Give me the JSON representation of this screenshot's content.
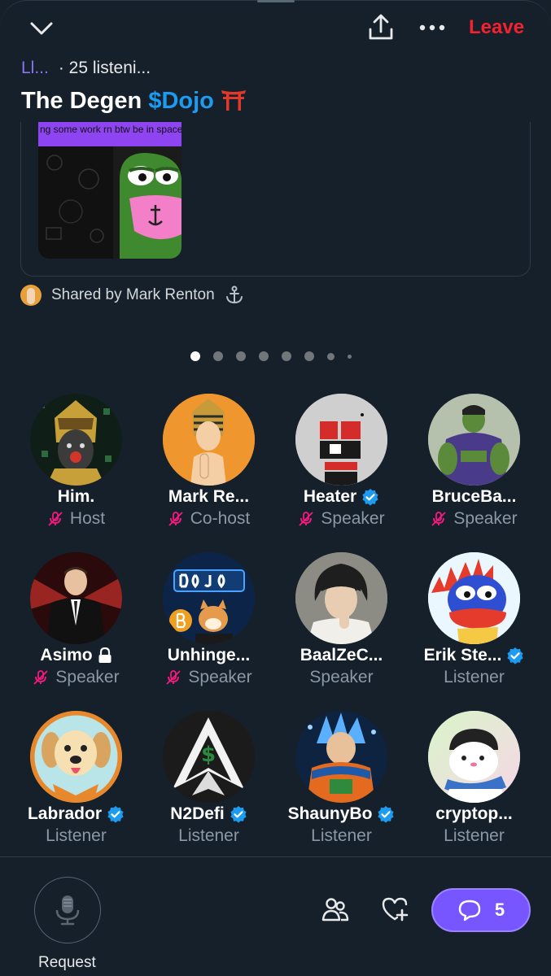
{
  "header": {
    "leave_label": "Leave",
    "host_short": "Ll...",
    "listeners": "· 25 listeni...",
    "title_prefix": "The Degen ",
    "title_cashtag": "$Dojo",
    "title_emoji": "torii-gate"
  },
  "shared_card": {
    "caption": "ng some work rn btw be in space",
    "shared_by": "Shared by Mark Renton",
    "shared_by_emoji": "anchor"
  },
  "carousel": {
    "count": 8,
    "active_index": 0
  },
  "participants": [
    {
      "name": "Him.",
      "role": "Host",
      "muted": true,
      "verified": false,
      "locked": false
    },
    {
      "name": "Mark Re...",
      "role": "Co-host",
      "muted": true,
      "verified": false,
      "locked": false
    },
    {
      "name": "Heater",
      "role": "Speaker",
      "muted": true,
      "verified": true,
      "locked": false
    },
    {
      "name": "BruceBa...",
      "role": "Speaker",
      "muted": true,
      "verified": false,
      "locked": false
    },
    {
      "name": "Asimo",
      "role": "Speaker",
      "muted": true,
      "verified": false,
      "locked": true
    },
    {
      "name": "Unhinge...",
      "role": "Speaker",
      "muted": true,
      "verified": false,
      "locked": false
    },
    {
      "name": "BaalZeC...",
      "role": "Speaker",
      "muted": false,
      "verified": false,
      "locked": false
    },
    {
      "name": "Erik Ste...",
      "role": "Listener",
      "muted": false,
      "verified": true,
      "locked": false
    },
    {
      "name": "Labrador",
      "role": "Listener",
      "muted": false,
      "verified": true,
      "locked": false
    },
    {
      "name": "N2Defi",
      "role": "Listener",
      "muted": false,
      "verified": true,
      "locked": false
    },
    {
      "name": "ShaunyBo",
      "role": "Listener",
      "muted": false,
      "verified": true,
      "locked": false
    },
    {
      "name": "cryptop...",
      "role": "Listener",
      "muted": false,
      "verified": false,
      "locked": false
    }
  ],
  "footer": {
    "request_label": "Request",
    "comments_count": "5"
  },
  "colors": {
    "background": "#15202b",
    "leave": "#f4212e",
    "verified": "#1d9bf0",
    "muted_mic": "#f91880",
    "comments_pill": "#7856ff"
  }
}
